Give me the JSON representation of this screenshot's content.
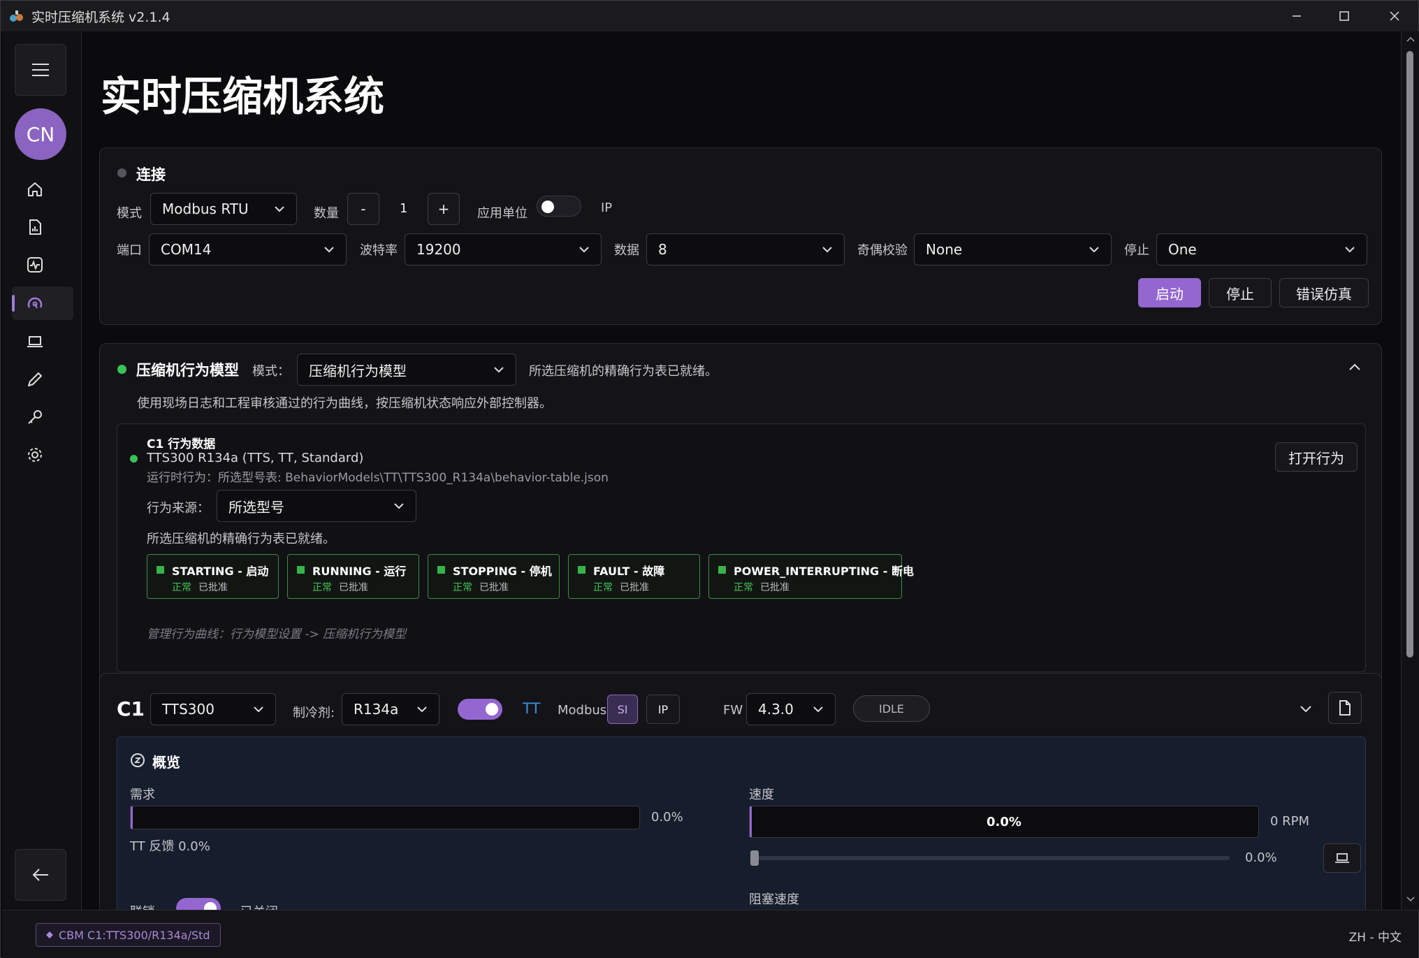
{
  "window": {
    "title": "实时压缩机系统 v2.1.4"
  },
  "sidebar": {
    "avatar": "CN"
  },
  "page": {
    "title": "实时压缩机系统"
  },
  "connection": {
    "title": "连接",
    "mode_label": "模式",
    "mode_value": "Modbus RTU",
    "count_label": "数量",
    "count_minus": "-",
    "count_value": "1",
    "count_plus": "+",
    "unit_label": "应用单位",
    "unit_toggle_right": "IP",
    "port_label": "端口",
    "port_value": "COM14",
    "baud_label": "波特率",
    "baud_value": "19200",
    "data_label": "数据",
    "data_value": "8",
    "parity_label": "奇偶校验",
    "parity_value": "None",
    "stop_label": "停止",
    "stop_value": "One",
    "start_btn": "启动",
    "stop_btn": "停止",
    "fault_btn": "错误仿真"
  },
  "behavior": {
    "title": "压缩机行为模型",
    "mode_label": "模式：",
    "mode_value": "压缩机行为模型",
    "ready_text": "所选压缩机的精确行为表已就绪。",
    "description": "使用现场日志和工程审核通过的行为曲线，按压缩机状态响应外部控制器。",
    "c1": {
      "title": "C1 行为数据",
      "model": "TTS300 R134a (TTS, TT, Standard)",
      "runtime": "运行时行为：所选型号表: BehaviorModels\\TT\\TTS300_R134a\\behavior-table.json",
      "source_label": "行为来源：",
      "source_value": "所选型号",
      "ready_text": "所选压缩机的精确行为表已就绪。",
      "open_btn": "打开行为",
      "states": [
        {
          "name": "STARTING - 启动",
          "status": "正常",
          "approval": "已批准"
        },
        {
          "name": "RUNNING - 运行",
          "status": "正常",
          "approval": "已批准"
        },
        {
          "name": "STOPPING - 停机",
          "status": "正常",
          "approval": "已批准"
        },
        {
          "name": "FAULT - 故障",
          "status": "正常",
          "approval": "已批准"
        },
        {
          "name": "POWER_INTERRUPTING - 断电",
          "status": "正常",
          "approval": "已批准"
        }
      ],
      "footer": "管理行为曲线：行为模型设置 -> 压缩机行为模型"
    }
  },
  "compressor": {
    "id": "C1",
    "model": "TTS300",
    "refrigerant_label": "制冷剂:",
    "refrigerant_value": "R134a",
    "tt_label": "TT",
    "modbus_label": "Modbus",
    "si_label": "SI",
    "ip_label": "IP",
    "fw_label": "FW",
    "fw_value": "4.3.0",
    "state_badge": "IDLE",
    "overview": {
      "title": "概览",
      "demand_label": "需求",
      "demand_value": "0.0%",
      "demand_fraction": 0.0,
      "tt_feedback": "TT 反馈 0.0%",
      "speed_label": "速度",
      "speed_bar_text": "0.0%",
      "speed_rpm": "0 RPM",
      "slider_value": "0.0%",
      "interlock_label": "联锁",
      "interlock_state": "已关闭",
      "choke_label": "阻塞速度"
    }
  },
  "statusbar": {
    "tag": "CBM C1:TTS300/R134a/Std",
    "language": "ZH - 中文"
  },
  "colors": {
    "accent": "#9466d0",
    "ok_green": "#38b34a",
    "tt_blue": "#3b8fe0"
  }
}
